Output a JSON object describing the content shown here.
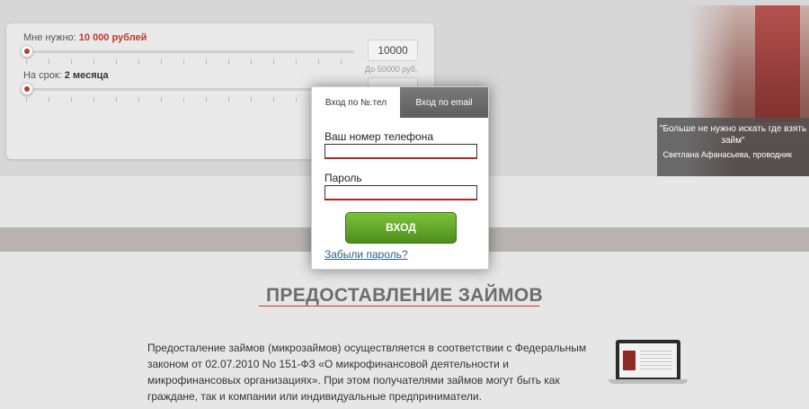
{
  "calculator": {
    "amount_label": "Мне нужно:",
    "amount_value": "10 000 рублей",
    "amount_input": "10000",
    "amount_hint": "До 50000 руб.",
    "term_label": "На срок:",
    "term_value": "2 месяца",
    "amount_fraction": 0.0,
    "term_fraction": 0.0
  },
  "testimonial": {
    "quote": "\"Больше не нужно искать где взять займ\"",
    "author": "Светлана Афанасьева, проводник"
  },
  "login": {
    "tab_phone": "Вход по №.тел",
    "tab_email": "Вход по email",
    "phone_label": "Ваш номер телефона",
    "password_label": "Пароль",
    "submit": "ВХОД",
    "forgot": "Забыли пароль?"
  },
  "section": {
    "title": "ПРЕДОСТАВЛЕНИЕ ЗАЙМОВ",
    "paragraph": "Предосталение займов (микрозаймов) осуществляется в соответствии с Федеральным законом от 02.07.2010 No 151-ФЗ «О микрофинансовой деятельности и микрофинансовых организациях». При этом получателями займов могут быть как граждане, так и компании или индивидуальные предприниматели."
  },
  "colors": {
    "accent": "#c0392b",
    "button_green": "#5da22a",
    "link": "#2f5d8a"
  }
}
